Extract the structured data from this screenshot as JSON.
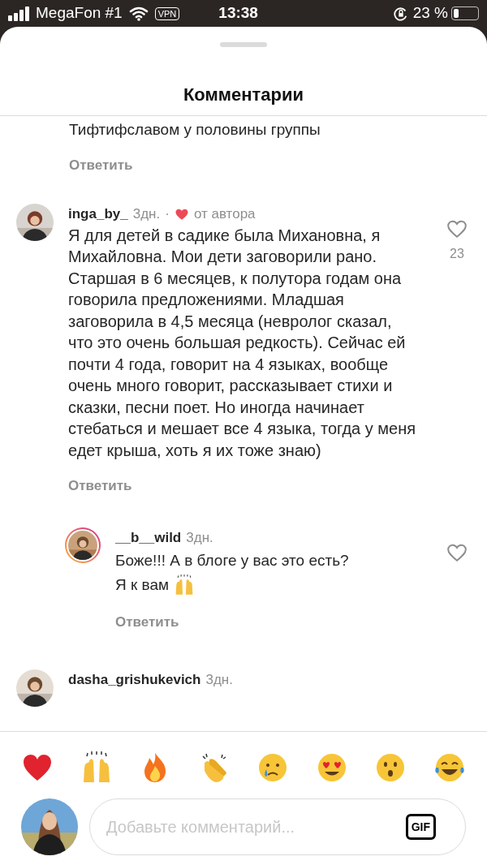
{
  "status_bar": {
    "carrier": "MegaFon #1",
    "vpn": "VPN",
    "time": "13:38",
    "battery_percent": "23 %"
  },
  "sheet": {
    "title": "Комментарии"
  },
  "comments": [
    {
      "kind": "tail",
      "text": "Тифтифславом у половины группы",
      "reply_label": "Ответить"
    },
    {
      "kind": "comment",
      "username": "inga_by_",
      "time": "3дн.",
      "separator": "·",
      "author_liked": true,
      "author_label": "от автора",
      "text": "Я для детей в садике была Михановна, я Михайловна. Мои дети заговорили рано. Старшая в 6 месяцев, к полутора годам она говорила предложениями. Младшая заговорила в 4,5 месяца (невролог сказал, что это очень большая редкость). Сейчас ей почти 4 года, говорит на 4 языках, вообще очень много говорит, рассказывает стихи и сказки, песни поет. Но иногда начинает стебаться и мешает все 4 языка, тогда у меня едет крыша, хоть я их тоже знаю)",
      "likes": "23",
      "liked": false,
      "has_story": false,
      "reply_label": "Ответить"
    },
    {
      "kind": "reply",
      "username": "__b__wild",
      "time": "3дн.",
      "lines": [
        "Боже!!! А в блоге у вас это есть?",
        "Я к вам"
      ],
      "liked": false,
      "has_story": true,
      "reply_label": "Ответить"
    },
    {
      "kind": "comment",
      "username": "dasha_grishukevich",
      "time": "3дн.",
      "has_story": false
    }
  ],
  "reactions": [
    {
      "kind": "heart"
    },
    {
      "kind": "raised_hands"
    },
    {
      "kind": "fire"
    },
    {
      "kind": "clap"
    },
    {
      "kind": "cry"
    },
    {
      "kind": "heart_eyes"
    },
    {
      "kind": "surprised"
    },
    {
      "kind": "laugh"
    }
  ],
  "composer": {
    "placeholder": "Добавьте комментарий...",
    "gif": "GIF"
  }
}
